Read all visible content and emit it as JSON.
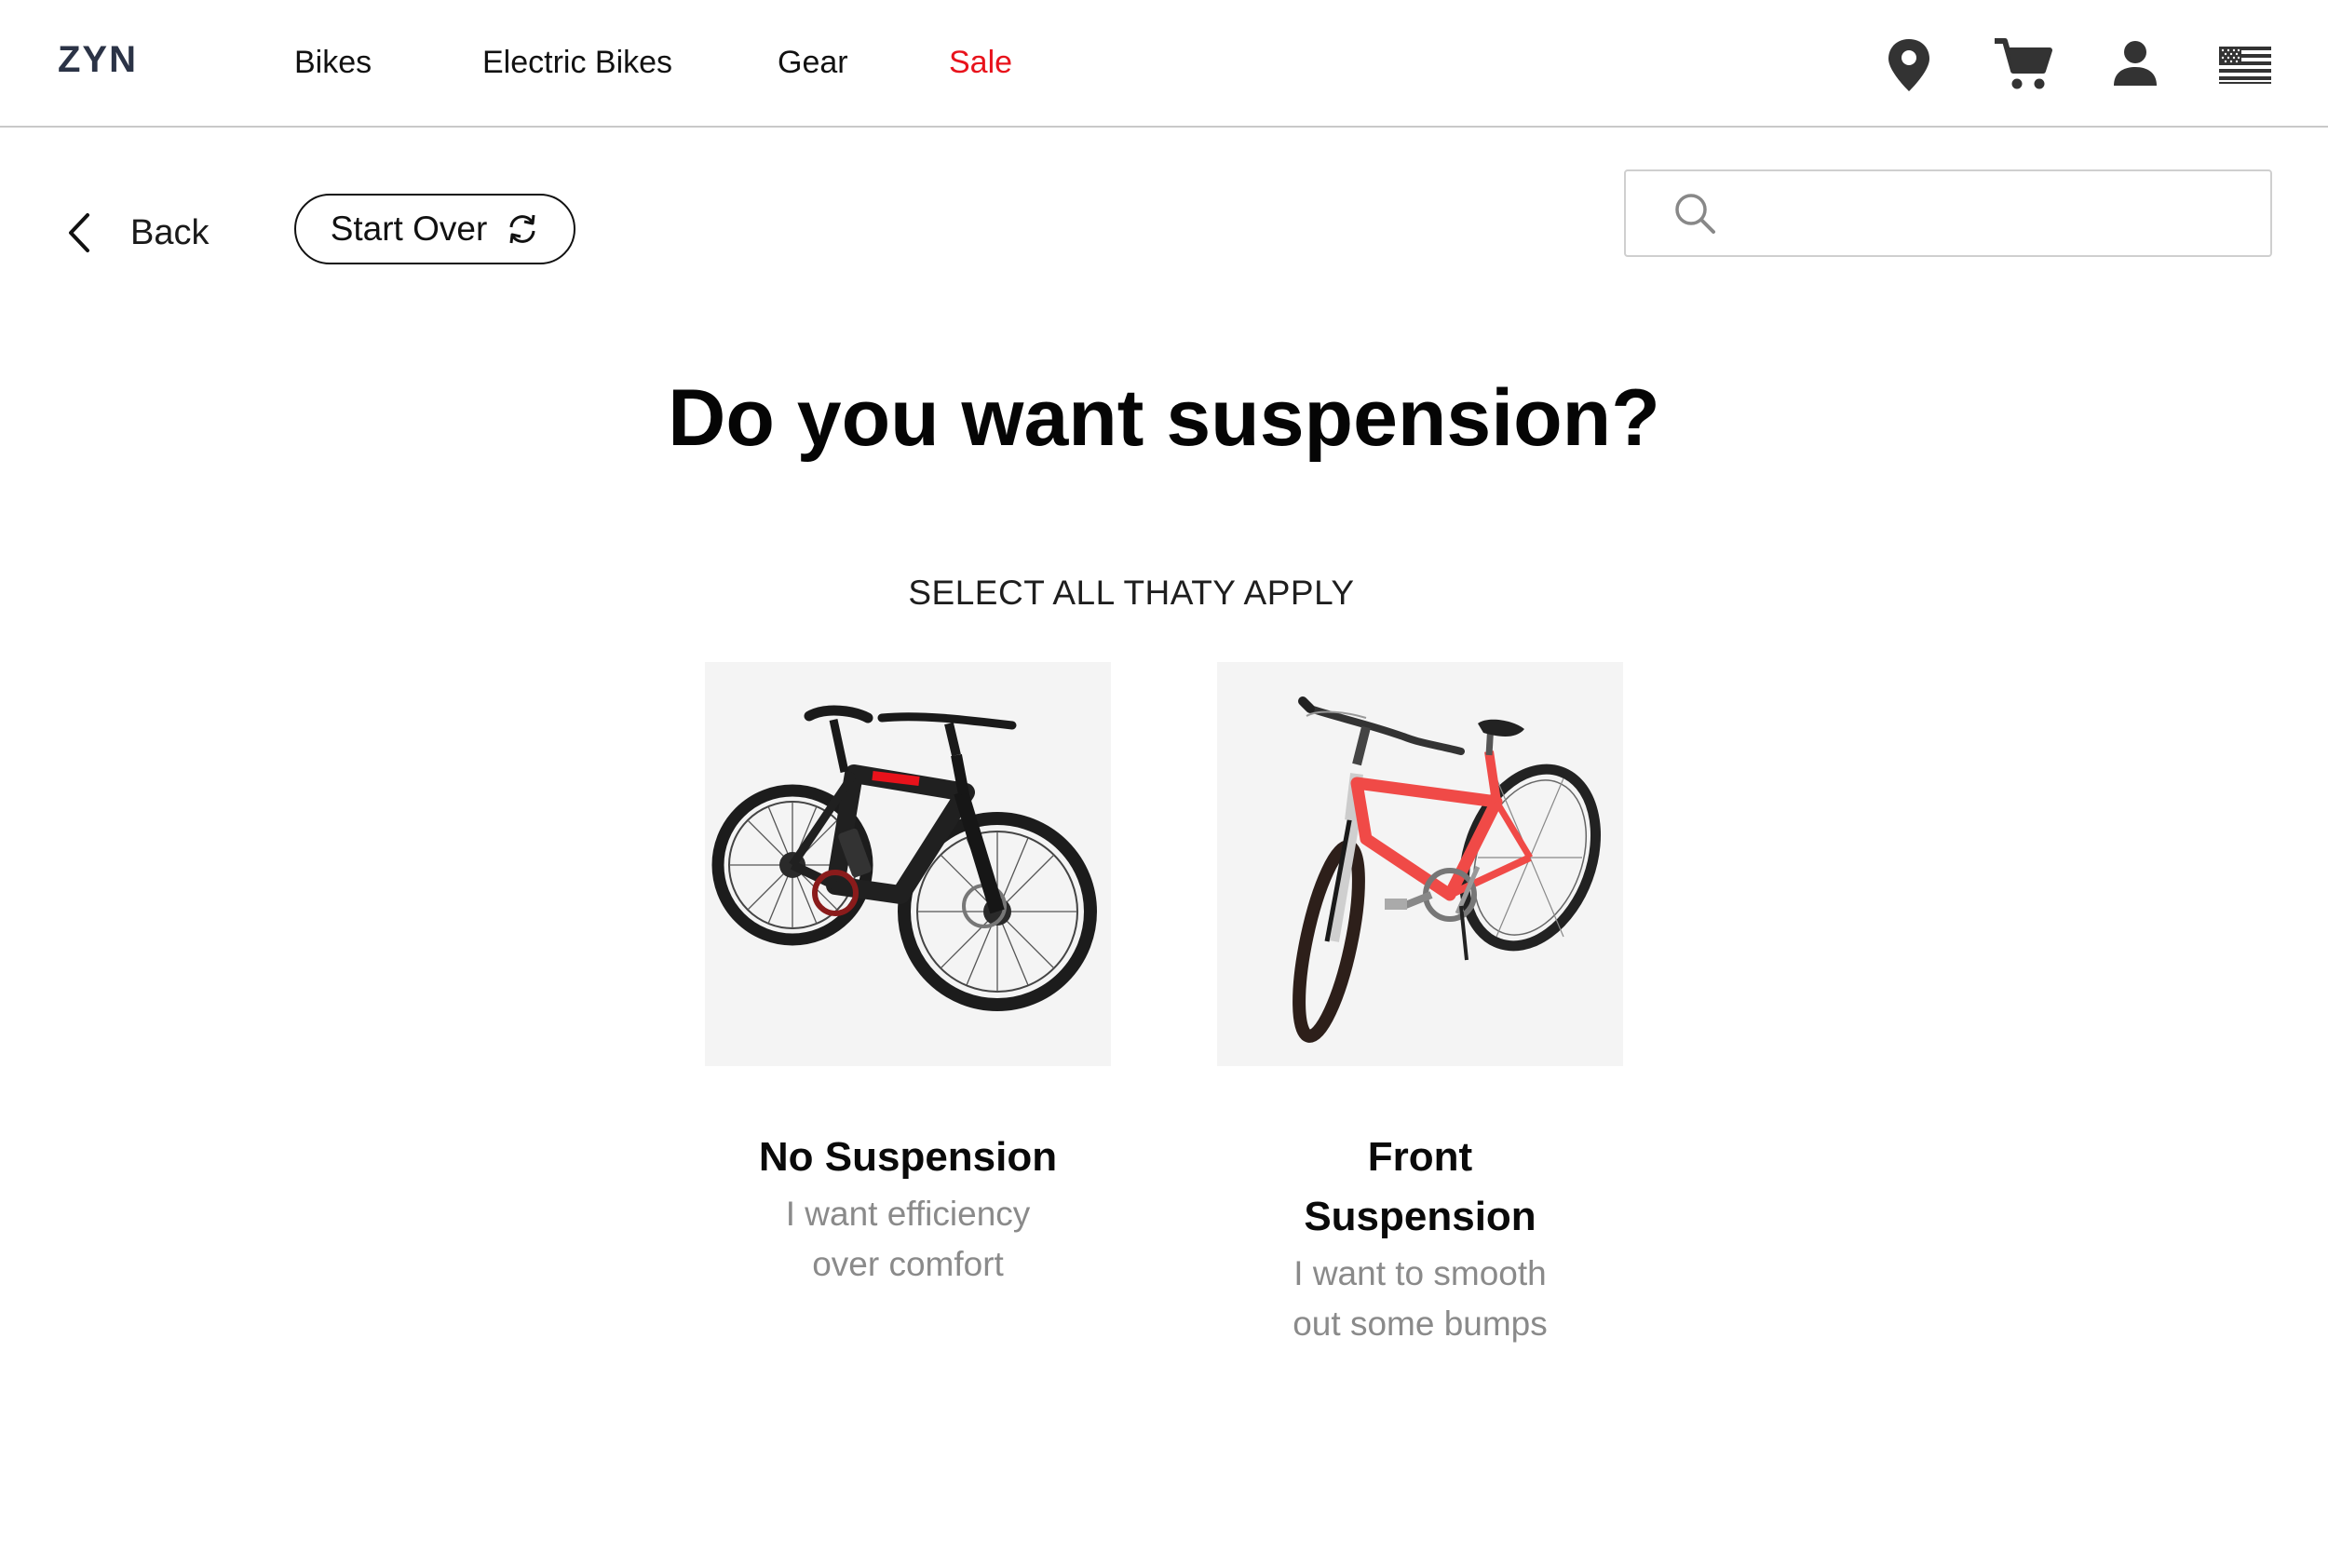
{
  "header": {
    "logo": "ZYN",
    "nav": [
      {
        "label": "Bikes"
      },
      {
        "label": "Electric Bikes"
      },
      {
        "label": "Gear"
      },
      {
        "label": "Sale"
      }
    ],
    "icons": [
      "location-pin-icon",
      "cart-icon",
      "user-icon",
      "us-flag-icon"
    ]
  },
  "toolbar": {
    "back_label": "Back",
    "start_over_label": "Start Over"
  },
  "search": {
    "placeholder": "",
    "value": ""
  },
  "quiz": {
    "question": "Do you want suspension?",
    "instruction": "SELECT ALL THATY APPLY",
    "options": [
      {
        "title": "No Suspension",
        "desc_line1": "I want efficiency",
        "desc_line2": "over comfort",
        "image": "black-mountain-bike"
      },
      {
        "title_line1": "Front",
        "title_line2": "Suspension",
        "desc_line1": "I want to smooth",
        "desc_line2": "out some bumps",
        "image": "red-hybrid-bike"
      }
    ]
  },
  "colors": {
    "sale": "#e8121b",
    "logo": "#2b3346",
    "card_bg": "#f4f4f4",
    "muted_text": "#8a8a8a",
    "bike_red": "#f04a47"
  }
}
